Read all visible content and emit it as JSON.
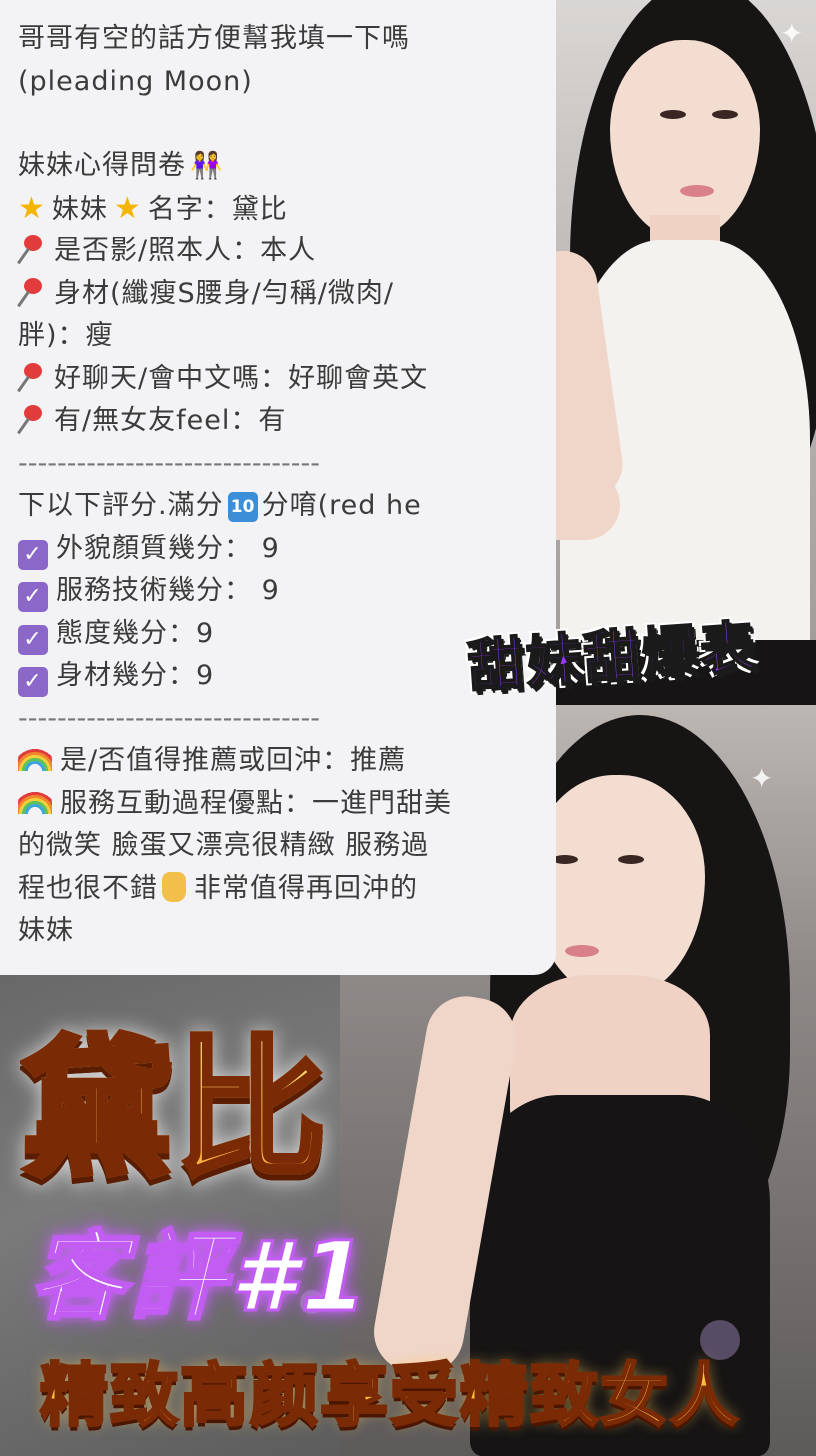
{
  "review_card": {
    "intro_line1": "哥哥有空的話方便幫我填一下嗎",
    "intro_line2": "(pleading Moon)",
    "questionnaire_title": "妹妹心得問卷",
    "name_line": "妹妹",
    "name_value": "名字：黛比",
    "photo_match": "是否影/照本人：本人",
    "body_type_1": "身材(纖瘦S腰身/勻稱/微肉/",
    "body_type_2": "胖)：瘦",
    "chat": "好聊天/會中文嗎：好聊會英文",
    "gf_feel": "有/無女友feel：有",
    "divider": "-------------------------------",
    "score_intro_a": "下以下評分.滿分",
    "score_intro_keycap": "10",
    "score_intro_b": "分唷(red he",
    "score_items": [
      "外貌顏質幾分： 9",
      "服務技術幾分： 9",
      "態度幾分：9",
      "身材幾分：9"
    ],
    "recommend": "是/否值得推薦或回沖：推薦",
    "highlights_1": "服務互動過程優點：一進門甜美",
    "highlights_2": "的微笑 臉蛋又漂亮很精緻 服務過",
    "highlights_3a": "程也很不錯",
    "highlights_3b": "非常值得再回沖的",
    "highlights_4": "妹妹"
  },
  "banner": {
    "sweet_label": "甜妹甜爆表",
    "name_title": "黛比",
    "review_title": "客評#1",
    "tagline": "精致高颜享受精致女人"
  },
  "colors": {
    "card_bg": "#f3f3f5",
    "checkbox": "#8a67c9",
    "banner_purple": "#9b38ff",
    "title_gold": "#ffcf5b",
    "review_glow": "#c25cf2"
  },
  "icons": [
    "star-icon",
    "pushpin-icon",
    "checkbox-icon",
    "rainbow-icon",
    "keycap-ten-icon",
    "thumbs-up-icon",
    "girls-icon"
  ]
}
